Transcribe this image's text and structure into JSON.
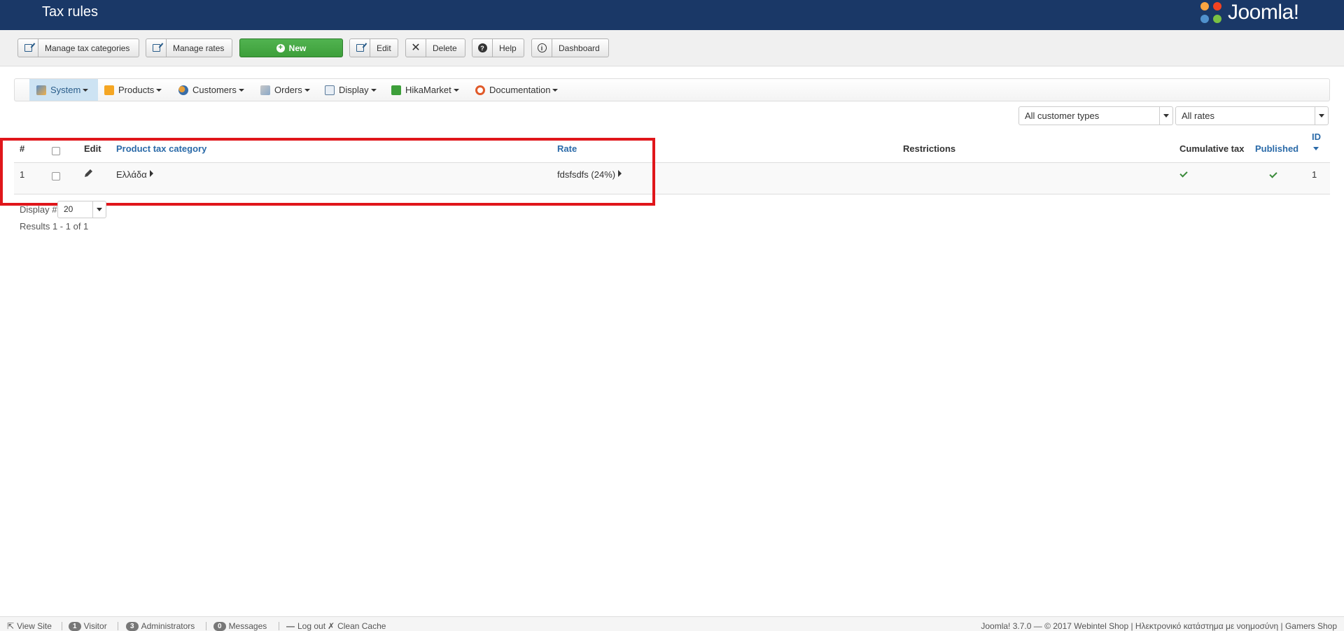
{
  "header": {
    "title": "Tax rules",
    "logo_text": "Joomla!"
  },
  "toolbar": {
    "manage_tax_categories": "Manage tax categories",
    "manage_rates": "Manage rates",
    "new": "New",
    "edit": "Edit",
    "delete": "Delete",
    "help": "Help",
    "dashboard": "Dashboard"
  },
  "menu": {
    "items": [
      {
        "label": "System",
        "icon": "wrench-icon"
      },
      {
        "label": "Products",
        "icon": "box-icon"
      },
      {
        "label": "Customers",
        "icon": "users-icon"
      },
      {
        "label": "Orders",
        "icon": "orders-icon"
      },
      {
        "label": "Display",
        "icon": "display-icon"
      },
      {
        "label": "HikaMarket",
        "icon": "hikamarket-icon"
      },
      {
        "label": "Documentation",
        "icon": "lifebuoy-icon"
      }
    ]
  },
  "filters": {
    "customer_types": "All customer types",
    "rates": "All rates"
  },
  "table": {
    "columns": {
      "num": "#",
      "edit": "Edit",
      "category": "Product tax category",
      "rate": "Rate",
      "restrictions": "Restrictions",
      "cumulative": "Cumulative tax",
      "published": "Published",
      "id": "ID"
    },
    "rows": [
      {
        "num": "1",
        "category": "Ελλάδα",
        "rate": "fdsfsdfs (24%)",
        "restrictions": "",
        "cumulative": true,
        "published": true,
        "id": "1"
      }
    ]
  },
  "pagination": {
    "display_label": "Display #",
    "display_value": "20",
    "results": "Results 1 - 1 of 1"
  },
  "statusbar": {
    "view_site": "View Site",
    "visitor_count": "1",
    "visitor_label": "Visitor",
    "admin_count": "3",
    "admin_label": "Administrators",
    "messages_count": "0",
    "messages_label": "Messages",
    "logout": "Log out",
    "clean_cache": "Clean Cache",
    "footer": "Joomla! 3.7.0  —  © 2017 Webintel Shop | Ηλεκτρονικό κατάστημα με νοημοσύνη | Gamers Shop"
  },
  "colors": {
    "header_bg": "#1a3867",
    "new_button": "#46a546",
    "link": "#2a6aa8",
    "highlight": "#e0161b",
    "check": "#3a8a3a"
  }
}
